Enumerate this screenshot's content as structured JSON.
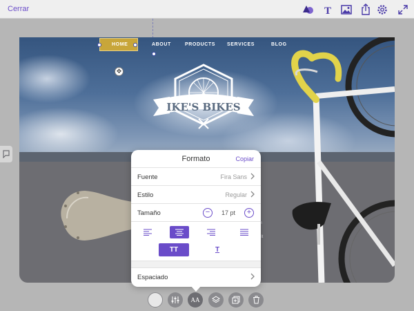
{
  "topbar": {
    "close_label": "Cerrar",
    "icons": [
      "shape-icon",
      "text-icon",
      "image-icon",
      "share-icon",
      "settings-icon",
      "expand-icon"
    ]
  },
  "site": {
    "nav": [
      "HOME",
      "ABOUT",
      "PRODUCTS",
      "SERVICES",
      "BLOG"
    ],
    "logo_text": "IKE'S BIKES"
  },
  "format_panel": {
    "title": "Formato",
    "copy_label": "Copiar",
    "font": {
      "label": "Fuente",
      "value": "Fira Sans"
    },
    "style": {
      "label": "Estilo",
      "value": "Regular"
    },
    "size": {
      "label": "Tamaño",
      "value": "17 pt"
    },
    "alignment": {
      "options": [
        "left",
        "center",
        "right",
        "justify"
      ],
      "selected": "center"
    },
    "case": {
      "uppercase_label": "TT",
      "underline_label": "T"
    },
    "spacing": {
      "label": "Espaciado"
    }
  },
  "bottom_toolbar": {
    "tools": [
      "color-swatch",
      "adjust-icon",
      "font-format-icon",
      "layers-icon",
      "duplicate-icon",
      "trash-icon"
    ],
    "font_format_label": "AA",
    "active": "font-format-icon"
  },
  "colors": {
    "accent": "#6a4cc9",
    "selection_nav": "#c8a63a",
    "background": "#b6b6b6"
  }
}
